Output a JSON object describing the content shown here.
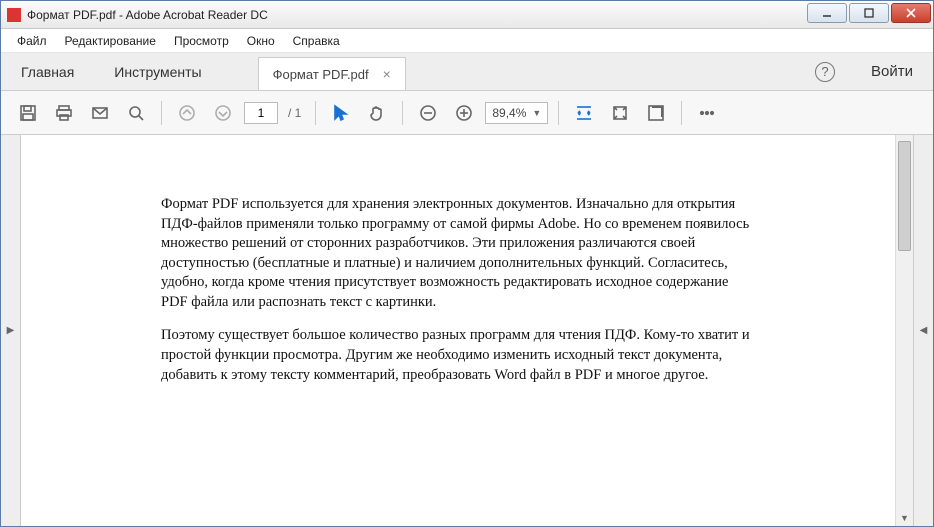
{
  "window": {
    "title": "Формат PDF.pdf - Adobe Acrobat Reader DC"
  },
  "menu": {
    "file": "Файл",
    "edit": "Редактирование",
    "view": "Просмотр",
    "window": "Окно",
    "help": "Справка"
  },
  "tabs": {
    "home": "Главная",
    "tools": "Инструменты",
    "doc": "Формат PDF.pdf",
    "signin": "Войти",
    "help_glyph": "?"
  },
  "toolbar": {
    "page_current": "1",
    "page_total": "/ 1",
    "zoom": "89,4%"
  },
  "document": {
    "p1": "Формат PDF используется для хранения электронных документов. Изначально для открытия ПДФ-файлов применяли только программу от самой фирмы Adobe. Но со временем появилось множество решений от сторонних разработчиков. Эти приложения различаются своей доступностью (бесплатные и платные) и наличием дополнительных функций. Согласитесь, удобно, когда кроме чтения присутствует возможность редактировать исходное содержание PDF файла или распознать текст с картинки.",
    "p2": "Поэтому существует большое количество разных программ для чтения ПДФ. Кому-то хватит и простой функции просмотра. Другим же необходимо изменить исходный текст документа, добавить к этому тексту комментарий, преобразовать Word файл в PDF и многое другое."
  }
}
